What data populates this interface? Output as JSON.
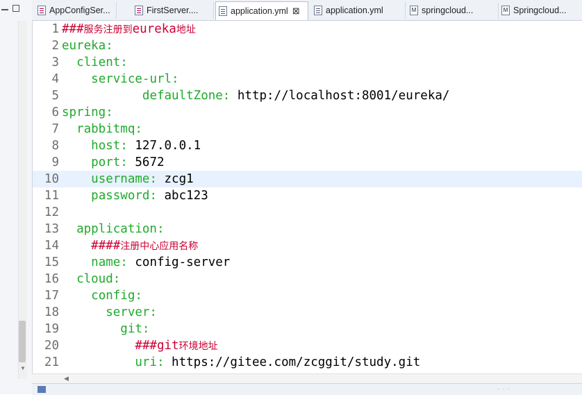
{
  "tabs": [
    {
      "label": "AppConfigSer...",
      "icon": "java-file-icon",
      "left": 0
    },
    {
      "label": "FirstServer....",
      "icon": "java-file-icon",
      "left": 0
    },
    {
      "label": "application.yml",
      "icon": "yml-file-icon",
      "active": true,
      "close": "⊠"
    },
    {
      "label": "application.yml",
      "icon": "yml-file-icon"
    },
    {
      "label": "springcloud...",
      "icon": "markdown-file-icon"
    },
    {
      "label": "Springcloud...",
      "icon": "markdown-file-icon"
    }
  ],
  "tab_icon_letter_md": "M",
  "editor": {
    "current_line": 10,
    "lines": [
      {
        "n": "1",
        "segs": [
          [
            "cmt",
            "###"
          ],
          [
            "cmt-cjk",
            "服务注册到"
          ],
          [
            "cmt",
            "eureka"
          ],
          [
            "cmt-cjk",
            "地址"
          ]
        ]
      },
      {
        "n": "2",
        "segs": [
          [
            "key",
            "eureka:"
          ]
        ]
      },
      {
        "n": "3",
        "segs": [
          [
            "val",
            "  "
          ],
          [
            "key",
            "client:"
          ]
        ]
      },
      {
        "n": "4",
        "segs": [
          [
            "val",
            "    "
          ],
          [
            "key",
            "service-url:"
          ]
        ]
      },
      {
        "n": "5",
        "segs": [
          [
            "val",
            "           "
          ],
          [
            "key",
            "defaultZone:"
          ],
          [
            "val",
            " http://localhost:8001/eureka/"
          ]
        ]
      },
      {
        "n": "6",
        "segs": [
          [
            "key",
            "spring:"
          ]
        ]
      },
      {
        "n": "7",
        "segs": [
          [
            "val",
            "  "
          ],
          [
            "key",
            "rabbitmq:"
          ]
        ]
      },
      {
        "n": "8",
        "segs": [
          [
            "val",
            "    "
          ],
          [
            "key",
            "host:"
          ],
          [
            "val",
            " 127.0.0.1"
          ]
        ]
      },
      {
        "n": "9",
        "segs": [
          [
            "val",
            "    "
          ],
          [
            "key",
            "port:"
          ],
          [
            "val",
            " 5672"
          ]
        ]
      },
      {
        "n": "10",
        "segs": [
          [
            "val",
            "    "
          ],
          [
            "key",
            "username:"
          ],
          [
            "val",
            " zcg1"
          ]
        ]
      },
      {
        "n": "11",
        "segs": [
          [
            "val",
            "    "
          ],
          [
            "key",
            "password:"
          ],
          [
            "val",
            " abc123"
          ]
        ]
      },
      {
        "n": "12",
        "segs": []
      },
      {
        "n": "13",
        "segs": [
          [
            "val",
            "  "
          ],
          [
            "key",
            "application:"
          ]
        ]
      },
      {
        "n": "14",
        "segs": [
          [
            "val",
            "    "
          ],
          [
            "cmt",
            "####"
          ],
          [
            "cmt-cjk",
            "注册中心应用名称"
          ]
        ]
      },
      {
        "n": "15",
        "segs": [
          [
            "val",
            "    "
          ],
          [
            "key",
            "name:"
          ],
          [
            "val",
            " config-server"
          ]
        ]
      },
      {
        "n": "16",
        "segs": [
          [
            "val",
            "  "
          ],
          [
            "key",
            "cloud:"
          ]
        ]
      },
      {
        "n": "17",
        "segs": [
          [
            "val",
            "    "
          ],
          [
            "key",
            "config:"
          ]
        ]
      },
      {
        "n": "18",
        "segs": [
          [
            "val",
            "      "
          ],
          [
            "key",
            "server:"
          ]
        ]
      },
      {
        "n": "19",
        "segs": [
          [
            "val",
            "        "
          ],
          [
            "key",
            "git:"
          ]
        ]
      },
      {
        "n": "20",
        "segs": [
          [
            "val",
            "          "
          ],
          [
            "cmt",
            "###git"
          ],
          [
            "cmt-cjk",
            "环境地址"
          ]
        ]
      },
      {
        "n": "21",
        "segs": [
          [
            "val",
            "          "
          ],
          [
            "key",
            "uri:"
          ],
          [
            "val",
            " https://gitee.com/zcggit/study.git"
          ]
        ]
      }
    ]
  },
  "colors": {
    "key": "#1faa2c",
    "comment": "#cc0033",
    "current_line": "#e8f2fe"
  }
}
